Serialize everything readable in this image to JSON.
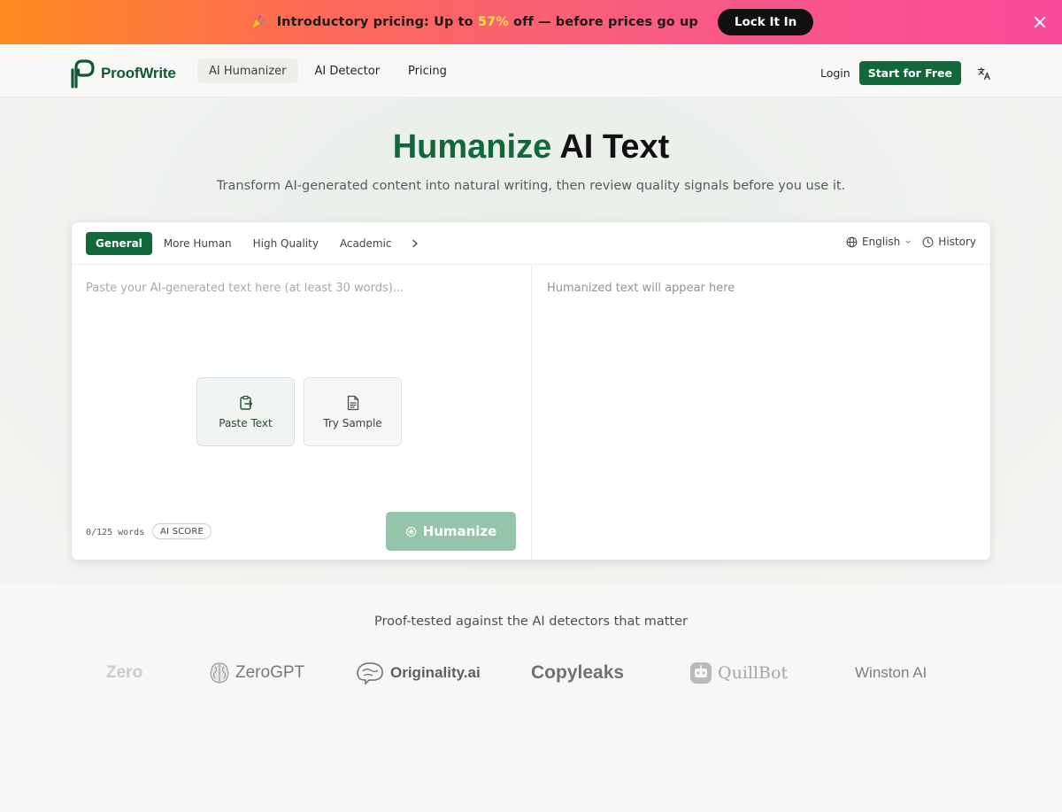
{
  "promo": {
    "text_before": "Introductory pricing: Up to ",
    "discount": "57%",
    "text_after": " off — before prices go up",
    "cta": "Lock It In",
    "accent": "#ffe24a"
  },
  "nav": {
    "brand": "ProofWrite",
    "links": [
      "AI Humanizer",
      "AI Detector",
      "Pricing"
    ],
    "active_link": "AI Humanizer",
    "login": "Login",
    "cta": "Start for Free",
    "brand_color": "#11683b"
  },
  "hero": {
    "title_green": "Humanize",
    "title_dark": " AI Text",
    "subtitle": "Transform AI-generated content into natural writing, then review quality signals before you use it."
  },
  "editor": {
    "modes": [
      "General",
      "More Human",
      "High Quality",
      "Academic"
    ],
    "active_mode": "General",
    "language": "English",
    "history": "History",
    "input_placeholder": "Paste your AI-generated text here (at least 30 words)...",
    "output_placeholder": "Humanized text will appear here",
    "paste_label": "Paste Text",
    "sample_label": "Try Sample",
    "word_count": "0/125 words",
    "ai_score_label": "AI SCORE",
    "humanize_label": "Humanize"
  },
  "proof": {
    "title": "Proof-tested against the AI detectors that matter",
    "logos": [
      "Zero",
      "ZeroGPT",
      "Originality.ai",
      "Copyleaks",
      "QuillBot",
      "Winston AI"
    ]
  },
  "icons": {
    "party": "party-popper-icon",
    "close": "close-icon",
    "translate": "translate-icon",
    "globe": "globe-icon",
    "clock": "clock-icon",
    "chevron": "chevron-right-icon",
    "clipboard": "clipboard-icon",
    "document": "document-icon",
    "sparkle": "sparkle-icon"
  }
}
